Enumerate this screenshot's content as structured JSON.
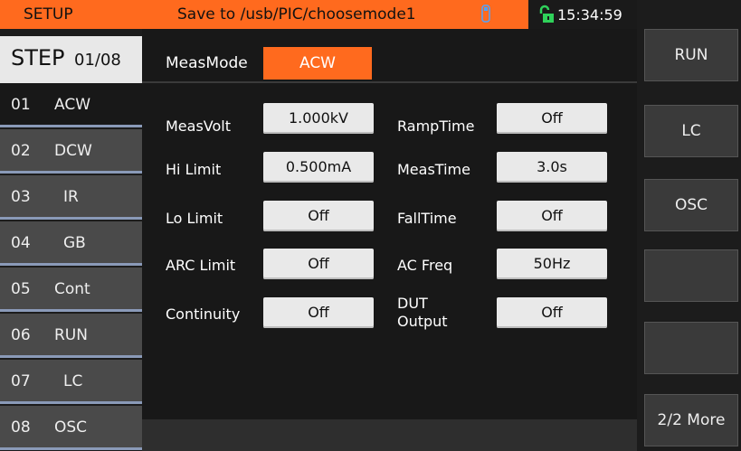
{
  "topbar": {
    "mode": "SETUP",
    "message": "Save to /usb/PIC/choosemode1",
    "time": "15:34:59",
    "usb_icon": "usb-icon",
    "lock_icon": "unlocked-icon",
    "accent": "#ff6a1e"
  },
  "step_header": {
    "label": "STEP",
    "counter": "01/08"
  },
  "steps": [
    {
      "num": "01",
      "name": "ACW"
    },
    {
      "num": "02",
      "name": "DCW"
    },
    {
      "num": "03",
      "name": "IR"
    },
    {
      "num": "04",
      "name": "GB"
    },
    {
      "num": "05",
      "name": "Cont"
    },
    {
      "num": "06",
      "name": "RUN"
    },
    {
      "num": "07",
      "name": "LC"
    },
    {
      "num": "08",
      "name": "OSC"
    }
  ],
  "meas_mode": {
    "label": "MeasMode",
    "value": "ACW"
  },
  "fields_left": [
    {
      "label": "MeasVolt",
      "value": "1.000kV"
    },
    {
      "label": "Hi Limit",
      "value": "0.500mA"
    },
    {
      "label": "Lo Limit",
      "value": "Off"
    },
    {
      "label": "ARC Limit",
      "value": "Off"
    },
    {
      "label": "Continuity",
      "value": "Off"
    }
  ],
  "fields_right": [
    {
      "label": "RampTime",
      "value": "Off"
    },
    {
      "label": "MeasTime",
      "value": "3.0s"
    },
    {
      "label": "FallTime",
      "value": "Off"
    },
    {
      "label": "AC Freq",
      "value": "50Hz"
    },
    {
      "label": "DUT",
      "label2": "Output",
      "value": "Off"
    }
  ],
  "softkeys": [
    "RUN",
    "LC",
    "OSC",
    "",
    "",
    "2/2 More"
  ]
}
